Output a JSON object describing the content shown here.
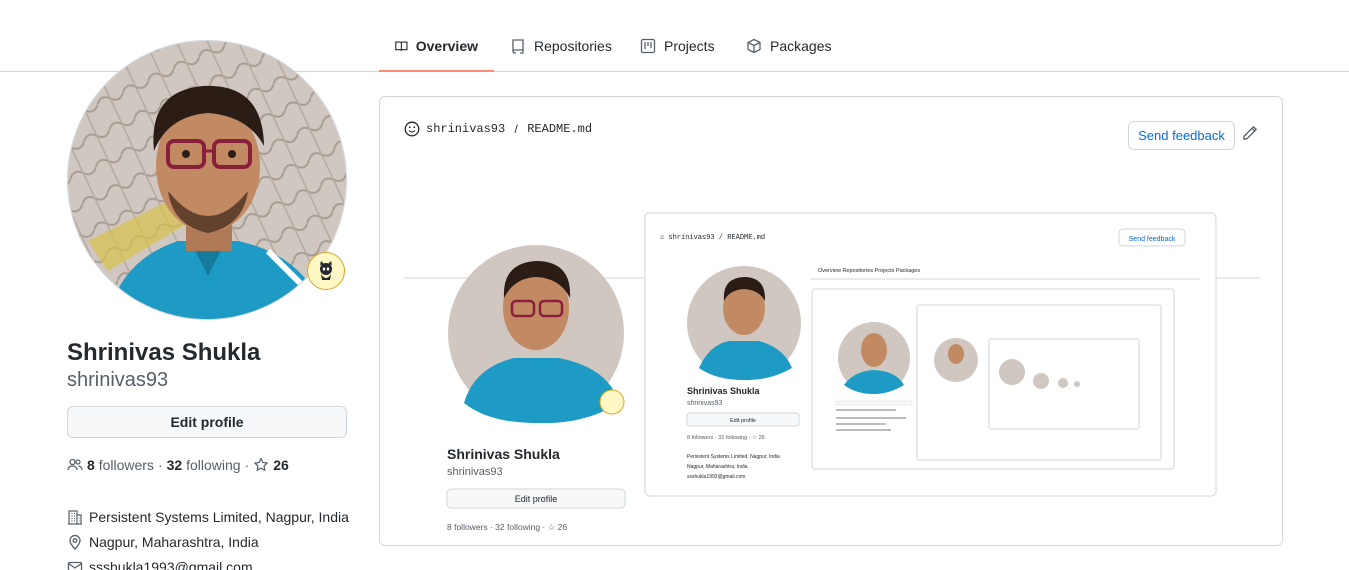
{
  "nav": {
    "tabs": [
      {
        "label": "Overview",
        "icon": "book-icon",
        "active": true
      },
      {
        "label": "Repositories",
        "icon": "repo-icon",
        "active": false
      },
      {
        "label": "Projects",
        "icon": "project-icon",
        "active": false
      },
      {
        "label": "Packages",
        "icon": "package-icon",
        "active": false
      }
    ]
  },
  "profile": {
    "name": "Shrinivas Shukla",
    "login": "shrinivas93",
    "edit_label": "Edit profile",
    "followers_count": "8",
    "followers_label": "followers",
    "following_count": "32",
    "following_label": "following",
    "stars_count": "26",
    "company": "Persistent Systems Limited, Nagpur, India",
    "location": "Nagpur, Maharashtra, India",
    "email": "ssshukla1993@gmail.com"
  },
  "readme": {
    "path_user": "shrinivas93",
    "path_sep": " / ",
    "path_file": "README.md",
    "feedback_label": "Send feedback"
  },
  "colors": {
    "active_tab_underline": "#fd8c73",
    "link_blue": "#0969da",
    "badge_bg": "#fff8c5",
    "avatar_shirt": "#1e9bc4"
  }
}
